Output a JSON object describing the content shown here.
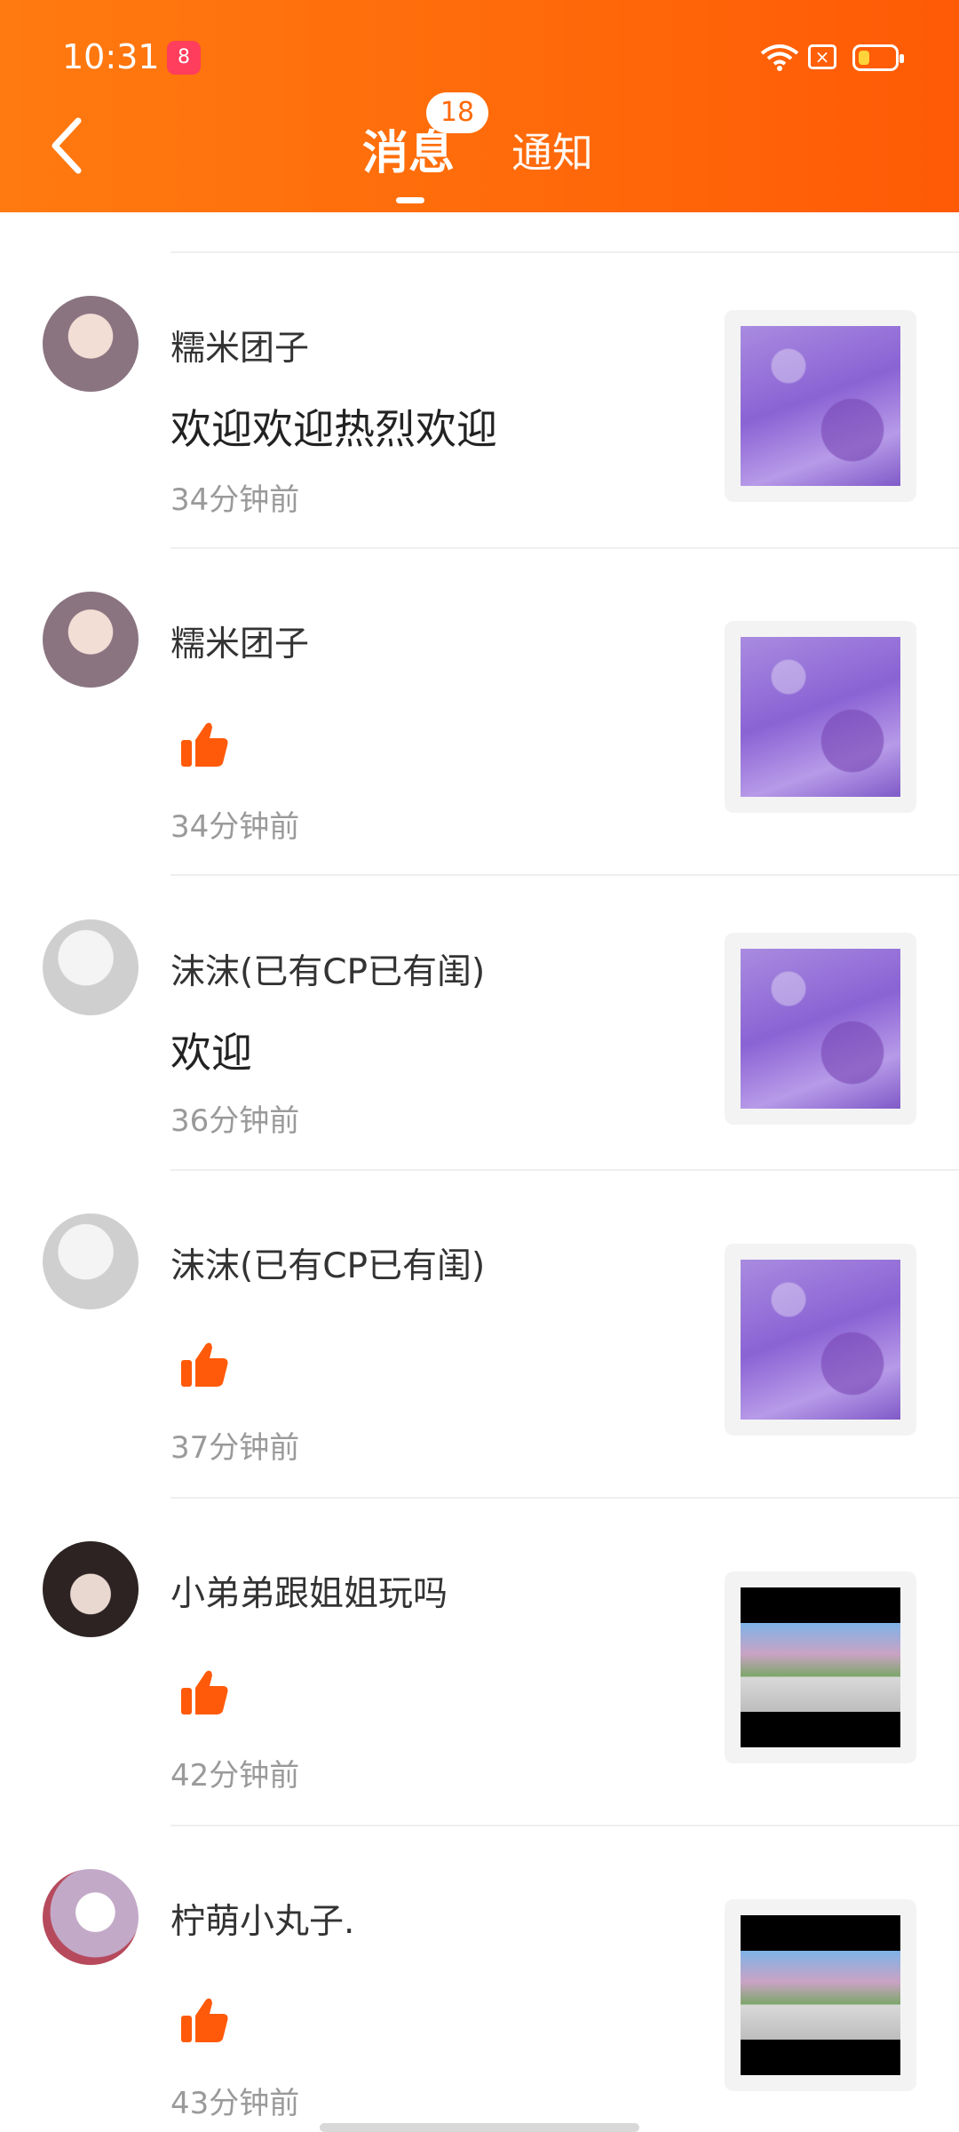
{
  "status_bar": {
    "time": "10:31",
    "app_icon_label": "8"
  },
  "header": {
    "tabs": [
      {
        "label": "消息"
      },
      {
        "label": "通知"
      }
    ],
    "badge_count": "18"
  },
  "messages": [
    {
      "user": "糯米团子",
      "content": "欢迎欢迎热烈欢迎",
      "type": "comment",
      "time": "34分钟前",
      "thumb": "purple"
    },
    {
      "user": "糯米团子",
      "content": "",
      "type": "like",
      "time": "34分钟前",
      "thumb": "purple"
    },
    {
      "user": "沫沫(已有CP已有闺)",
      "content": "欢迎",
      "type": "comment",
      "time": "36分钟前",
      "thumb": "purple"
    },
    {
      "user": "沫沫(已有CP已有闺)",
      "content": "",
      "type": "like",
      "time": "37分钟前",
      "thumb": "purple"
    },
    {
      "user": "小弟弟跟姐姐玩吗",
      "content": "",
      "type": "like",
      "time": "42分钟前",
      "thumb": "game"
    },
    {
      "user": "柠萌小丸子.",
      "content": "",
      "type": "like",
      "time": "43分钟前",
      "thumb": "game"
    }
  ],
  "colors": {
    "header": "#ff6a0a",
    "like_icon": "#ff5a0a",
    "time_text": "#9a9a9a"
  },
  "icons": {
    "back": "chevron-left-icon",
    "like": "thumbs-up-icon"
  }
}
